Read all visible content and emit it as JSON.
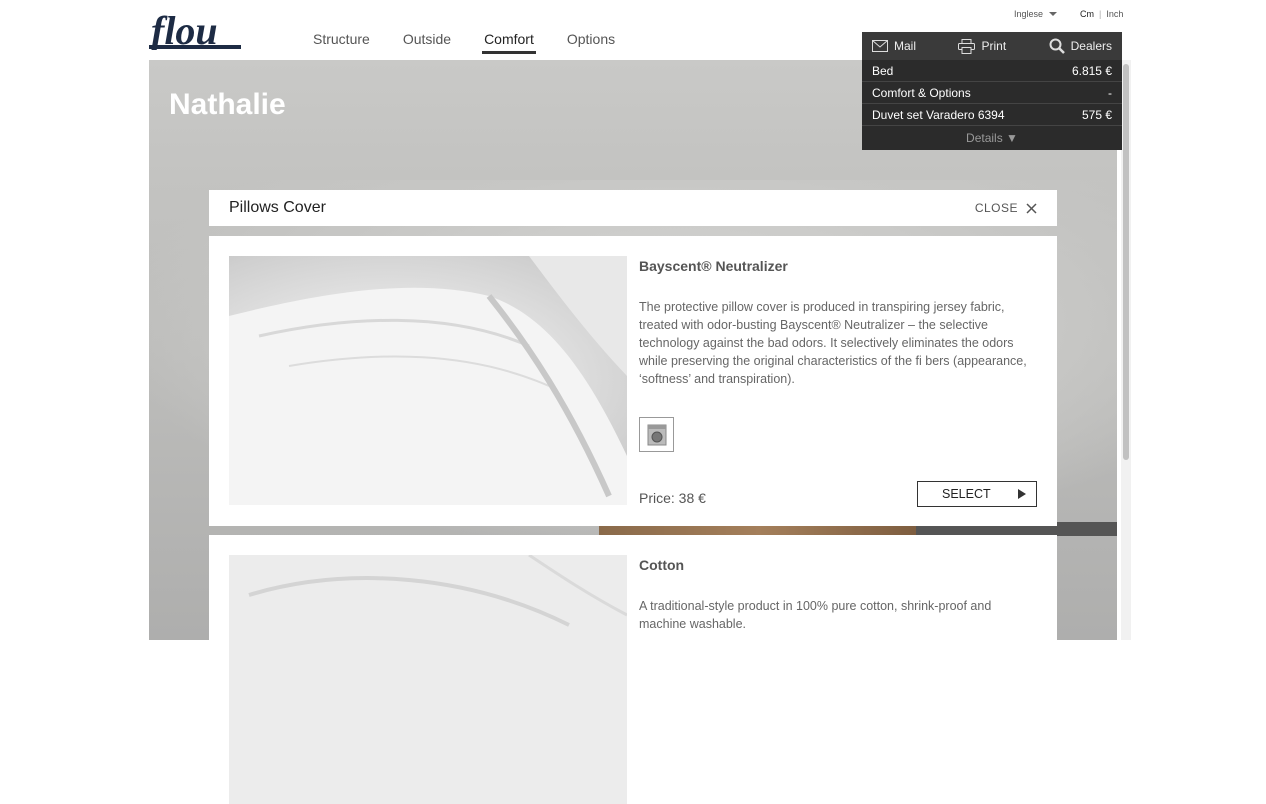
{
  "header": {
    "brand": "flou",
    "language": "Inglese",
    "units": [
      "Cm",
      "Inch"
    ],
    "active_unit": "Cm"
  },
  "nav": {
    "tabs": [
      {
        "label": "Structure",
        "active": false
      },
      {
        "label": "Outside",
        "active": false
      },
      {
        "label": "Comfort",
        "active": true
      },
      {
        "label": "Options",
        "active": false
      }
    ]
  },
  "page": {
    "title": "Nathalie"
  },
  "summary": {
    "tools": {
      "mail": "Mail",
      "print": "Print",
      "dealers": "Dealers"
    },
    "rows": [
      {
        "label": "Bed",
        "value": "6.815 €"
      },
      {
        "label": "Comfort & Options",
        "value": "-"
      },
      {
        "label": "Duvet set Varadero 6394",
        "value": "575 €"
      }
    ],
    "details": "Details ▼"
  },
  "modal": {
    "title": "Pillows Cover",
    "close_label": "CLOSE"
  },
  "products": [
    {
      "name": "Bayscent® Neutralizer",
      "description": "The protective pillow cover is produced in transpiring jersey fabric, treated with odor-busting Bayscent® Neutralizer – the selective technology against the bad odors. It selectively eliminates the odors while preserving the original characteristics of the fi bers (appearance, ‘softness’ and transpiration).",
      "price": "Price: 38 €",
      "select_label": "SELECT",
      "icon": "washing-machine-icon"
    },
    {
      "name": "Cotton",
      "description": "A traditional-style product in 100% pure cotton, shrink-proof and machine washable."
    }
  ],
  "colors": {
    "panel_bg": "#2b2b2b",
    "logo": "#1d2b44",
    "stage_bg": "#c3c3c1"
  }
}
